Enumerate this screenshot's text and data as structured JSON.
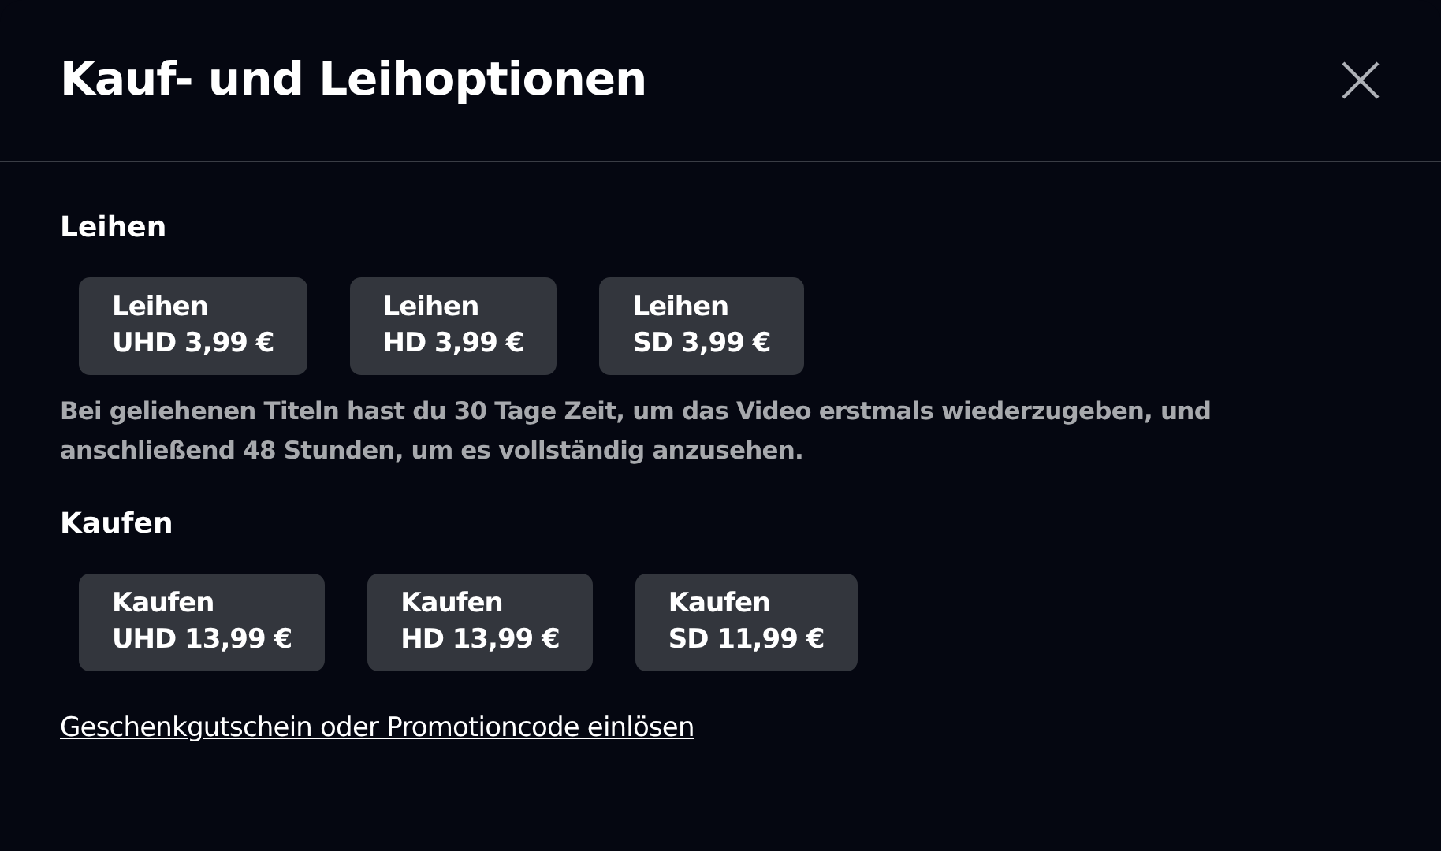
{
  "dialog": {
    "title": "Kauf- und Leihoptionen"
  },
  "sections": [
    {
      "heading": "Leihen",
      "options": [
        {
          "action": "Leihen",
          "price": "UHD 3,99 €"
        },
        {
          "action": "Leihen",
          "price": "HD 3,99 €"
        },
        {
          "action": "Leihen",
          "price": "SD 3,99 €"
        }
      ],
      "note": "Bei geliehenen Titeln hast du 30 Tage Zeit, um das Video erstmals wiederzugeben, und anschließend 48 Stunden, um es vollständig anzusehen."
    },
    {
      "heading": "Kaufen",
      "options": [
        {
          "action": "Kaufen",
          "price": "UHD 13,99 €"
        },
        {
          "action": "Kaufen",
          "price": "HD 13,99 €"
        },
        {
          "action": "Kaufen",
          "price": "SD 11,99 €"
        }
      ]
    }
  ],
  "redeem_link": "Geschenkgutschein oder Promotioncode einlösen"
}
